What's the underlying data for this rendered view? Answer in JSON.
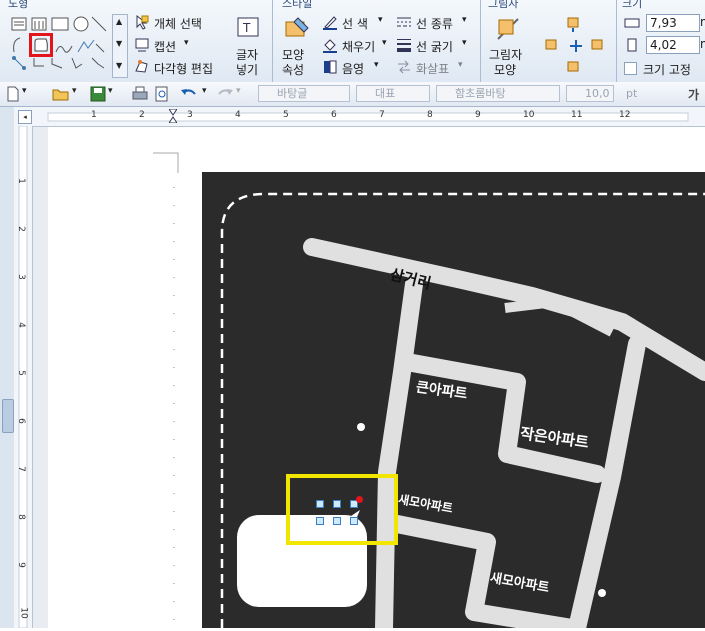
{
  "ribbon": {
    "groups": {
      "draw_title": "도형",
      "style_title": "스타일",
      "shadow_title": "그림자",
      "size_title": "크기"
    },
    "draw": {
      "select_object": "개체 선택",
      "caption": "캡션",
      "polygon_edit": "다각형 편집",
      "text_box_line1": "글자",
      "text_box_line2": "넣기"
    },
    "style": {
      "shape_props_line1": "모양",
      "shape_props_line2": "속성",
      "line_color": "선 색",
      "fill": "채우기",
      "shade": "음영",
      "line_type": "선 종류",
      "line_thickness": "선 굵기",
      "arrow": "화살표"
    },
    "shadow": {
      "shadow_shape_line1": "그림자",
      "shadow_shape_line2": "모양"
    },
    "size": {
      "width_value": "7,93",
      "height_value": "4,02",
      "width_unit": "m",
      "height_unit": "m",
      "fix_size": "크기 고정"
    }
  },
  "toolbar": {
    "style_value": "바탕글",
    "lang_value": "대표",
    "font_value": "함초롬바탕",
    "size_value": "10,0",
    "size_unit": "pt",
    "bold_label": "가"
  },
  "hruler": {
    "ticks": [
      "1",
      "2",
      "3",
      "4",
      "5",
      "6",
      "7",
      "8",
      "9",
      "10",
      "11",
      "12"
    ]
  },
  "vruler": {
    "ticks": [
      "1",
      "2",
      "3",
      "4",
      "5",
      "6",
      "7",
      "8",
      "9",
      "10"
    ]
  },
  "map": {
    "labels": {
      "crossroad": "삼거리",
      "big_apt": "큰아파트",
      "small_apt": "작은아파트",
      "new_apt1": "새모아파트",
      "new_apt2": "새모아파트"
    }
  },
  "colors": {
    "map_bg": "#2b2b2b",
    "road": "#e0e0e0",
    "highlight_yellow": "#f2e600",
    "highlight_red": "#e3141b"
  }
}
